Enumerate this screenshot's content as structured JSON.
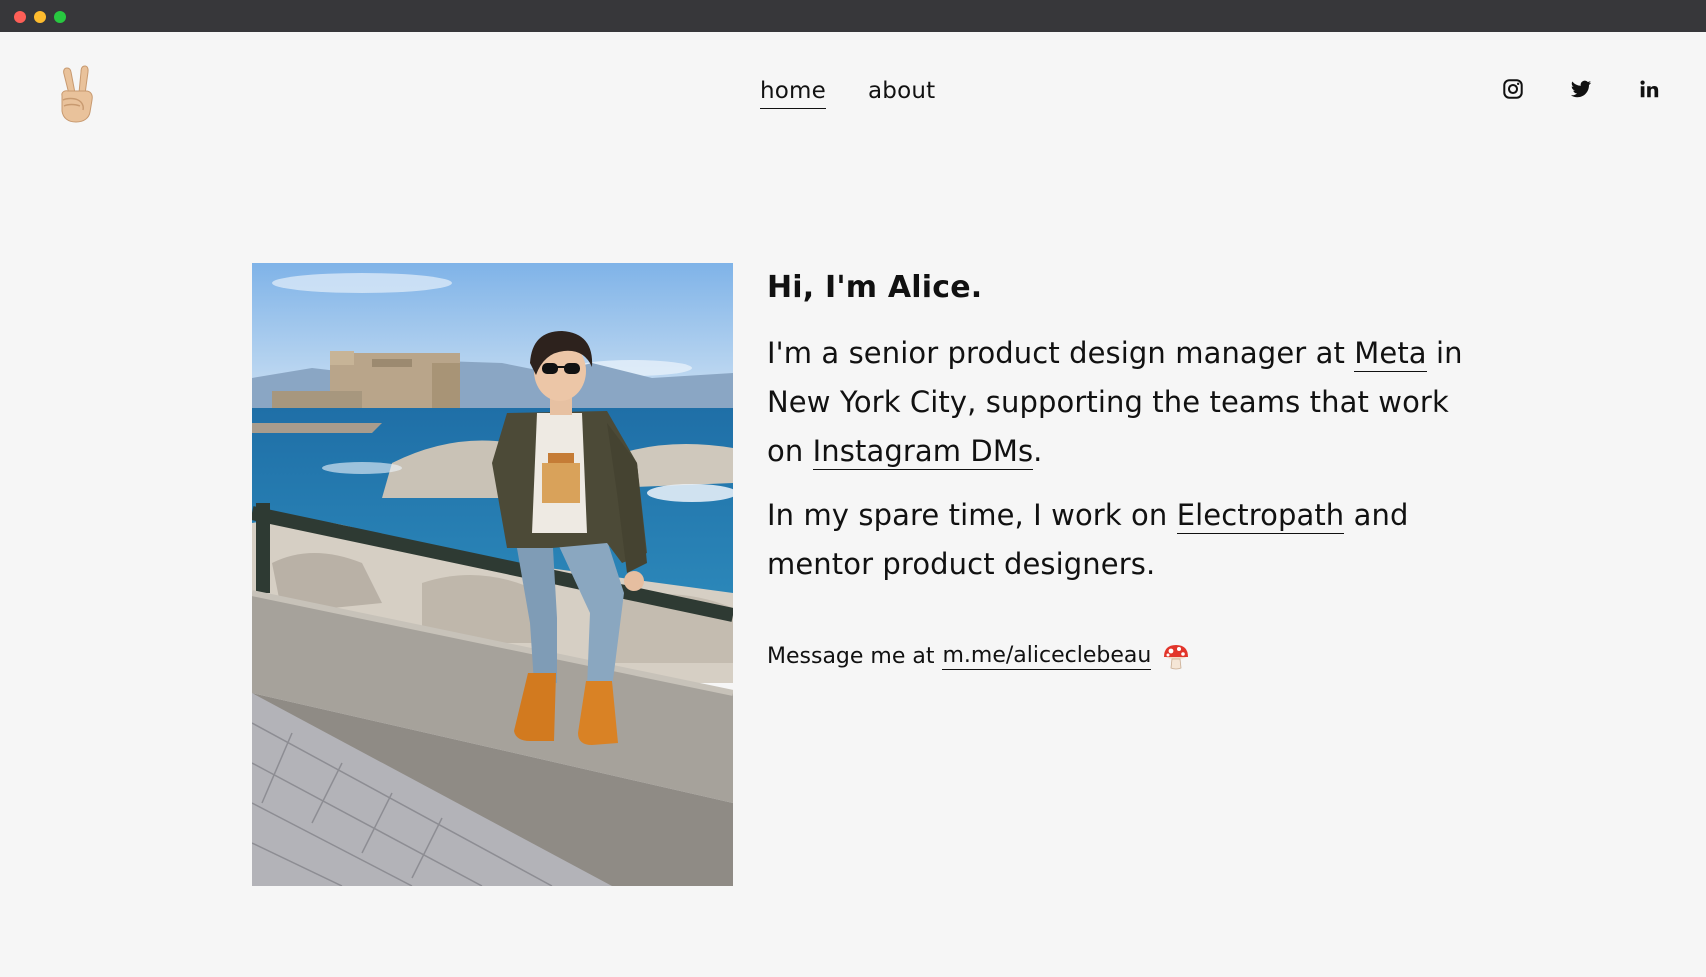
{
  "nav": {
    "items": [
      {
        "label": "home",
        "active": true
      },
      {
        "label": "about",
        "active": false
      }
    ]
  },
  "social": {
    "icons": [
      "instagram-icon",
      "twitter-icon",
      "linkedin-icon"
    ]
  },
  "logo": {
    "icon": "victory-hand-icon"
  },
  "bio": {
    "title": "Hi, I'm Alice.",
    "p1": {
      "line1_pre": "I'm a senior product design manager at ",
      "link_meta": "Meta",
      "line1_post": " in",
      "line2": "New York City, supporting the teams that work",
      "line3_pre": "on ",
      "link_dms": "Instagram DMs",
      "line3_post": "."
    },
    "p2": {
      "line1_pre": "In my spare time, I work on ",
      "link_electropath": "Electropath",
      "line1_post": " and",
      "line2": "mentor product designers."
    },
    "contact": {
      "prefix": "Message me at ",
      "link": "m.me/aliceclebeau",
      "emoji": "mushroom-icon"
    }
  },
  "colors": {
    "background": "#f6f6f6",
    "text": "#111111",
    "chrome": "#37373a"
  }
}
